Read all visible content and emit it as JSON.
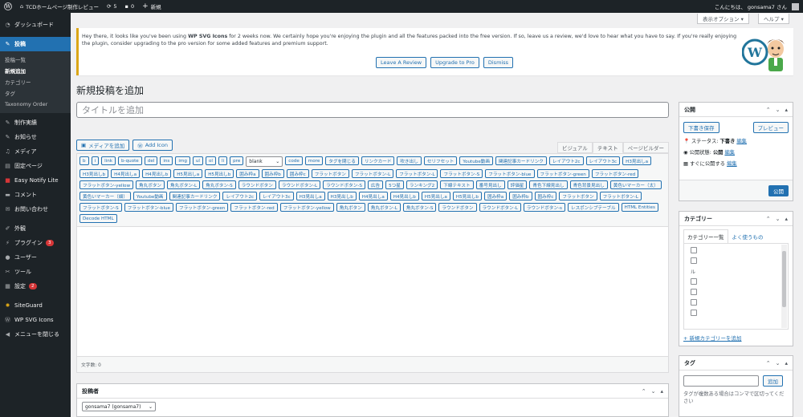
{
  "adminbar": {
    "site_name": "TCDホームページ制作レビュー",
    "updates_count": "5",
    "comments_count": "0",
    "new_label": "新規",
    "greeting": "こんにちは、 gonsama7 さん"
  },
  "sidebar": {
    "dashboard": "ダッシュボード",
    "posts": "投稿",
    "posts_sub": [
      "投稿一覧",
      "新規追加",
      "カテゴリー",
      "タグ",
      "Taxonomy Order"
    ],
    "items": [
      {
        "label": "制作実績",
        "icon": "pin-icon"
      },
      {
        "label": "お知らせ",
        "icon": "pin-icon"
      },
      {
        "label": "メディア",
        "icon": "media-icon"
      },
      {
        "label": "固定ページ",
        "icon": "page-icon"
      },
      {
        "label": "Easy Notify Lite",
        "icon": "notify-icon"
      },
      {
        "label": "コメント",
        "icon": "comment-icon"
      },
      {
        "label": "お問い合わせ",
        "icon": "mail-icon"
      }
    ],
    "items2": [
      {
        "label": "外観",
        "icon": "brush-icon"
      },
      {
        "label": "プラグイン",
        "icon": "plugin-icon",
        "badge": "3"
      },
      {
        "label": "ユーザー",
        "icon": "user-icon"
      },
      {
        "label": "ツール",
        "icon": "wrench-icon"
      },
      {
        "label": "設定",
        "icon": "settings-icon",
        "badge": "2"
      }
    ],
    "items3": [
      {
        "label": "SiteGuard",
        "icon": "guard-icon"
      },
      {
        "label": "WP SVG Icons",
        "icon": "wp-icon"
      },
      {
        "label": "メニューを閉じる",
        "icon": "collapse-icon"
      }
    ]
  },
  "screen_options": {
    "display_options": "表示オプション ▾",
    "help": "ヘルプ ▾"
  },
  "notice": {
    "text_before": "Hey there, it looks like you've been using ",
    "plugin_name": "WP SVG Icons",
    "text_after": " for 2 weeks now. We certainly hope you're enjoying the plugin and all the features packed into the free version. If so, leave us a review, we'd love to hear what you have to say. If you're really enjoying the plugin, consider upgrading to the pro version for some added features and premium support.",
    "buttons": [
      "Leave A Review",
      "Upgrade to Pro",
      "Dismiss"
    ]
  },
  "page": {
    "title": "新規投稿を追加",
    "title_placeholder": "タイトルを追加"
  },
  "editor": {
    "media_buttons": [
      "メディアを追加",
      "Add Icon"
    ],
    "tabs": [
      "ビジュアル",
      "テキスト",
      "ページビルダー"
    ],
    "quicktags": [
      "b",
      "i",
      "link",
      "b-quote",
      "del",
      "ins",
      "img",
      "ul",
      "ol",
      "li",
      "pre"
    ],
    "select_value": "blank",
    "quicktags2": [
      "code",
      "more",
      "タグを閉じる",
      "リンクカード",
      "吹き出し",
      "セリフセット",
      "Youtube動画",
      "関連記事カードリンク",
      "レイアウト2c",
      "レイアウト3c",
      "H3見出しa",
      "H3見出しb",
      "H4見出しa",
      "H4見出しb",
      "H5見出しa",
      "H5見出しb",
      "囲み枠a",
      "囲み枠b",
      "囲み枠c",
      "フラットボタン",
      "フラットボタン-L",
      "フラットボタン-L",
      "フラットボタン-S",
      "フラットボタン-blue",
      "フラットボタン-green",
      "フラットボタン-red",
      "フラットボタン-yellow",
      "角丸ボタン",
      "角丸ボタン-L",
      "角丸ボタン-S",
      "ラウンドボタン",
      "ラウンドボタン-L",
      "ラウンドボタン-S",
      "広告",
      "5つ星",
      "ランキング2",
      "下線テキスト",
      "番号見出し",
      "評価星",
      "青色下線見出し",
      "青色背景見出し",
      "黄色いマーカー（太）",
      "黄色いマーカー（細）",
      "Youtube動画",
      "関連記事カードリンク",
      "レイアウト2c",
      "レイアウト3c",
      "H3見出しa",
      "H3見出しb",
      "H4見出しa",
      "H4見出しb",
      "H5見出しa",
      "H5見出しb",
      "囲み枠a",
      "囲み枠b",
      "囲み枠c",
      "フラットボタン",
      "フラットボタン-L",
      "フラットボタン-S",
      "フラットボタン-blue",
      "フラットボタン-green",
      "フラットボタン-red",
      "フラットボタン-yellow",
      "角丸ボタン",
      "角丸ボタン-L",
      "角丸ボタン-S",
      "ラウンドボタン",
      "ラウンドボタン-L",
      "ラウンドボタン-s",
      "レスポンシブテーブル",
      "HTML Entities",
      "Decode HTML"
    ],
    "word_count": "文字数: 0"
  },
  "author_box": {
    "title": "投稿者",
    "selected": "gonsama7 (gonsama7)"
  },
  "publish_box": {
    "title": "公開",
    "save_draft": "下書き保存",
    "preview": "プレビュー",
    "status_label": "ステータス: ",
    "status_value": "下書き",
    "visibility_label": "公開状態: ",
    "visibility_value": "公開",
    "schedule_label": "すぐに公開する",
    "edit": "編集",
    "publish": "公開"
  },
  "category_box": {
    "title": "カテゴリー",
    "tab_all": "カテゴリー一覧",
    "tab_popular": "よく使うもの",
    "add_new": "+ 新規カテゴリーを追加",
    "partial_label": "ル"
  },
  "tag_box": {
    "title": "タグ",
    "add": "追加",
    "hint": "タグが複数ある場合はコンマで区切ってください"
  },
  "colors": {
    "accent": "#2271b1",
    "adminbar": "#1d2327",
    "notice_border": "#dba617",
    "badge": "#d63638"
  }
}
